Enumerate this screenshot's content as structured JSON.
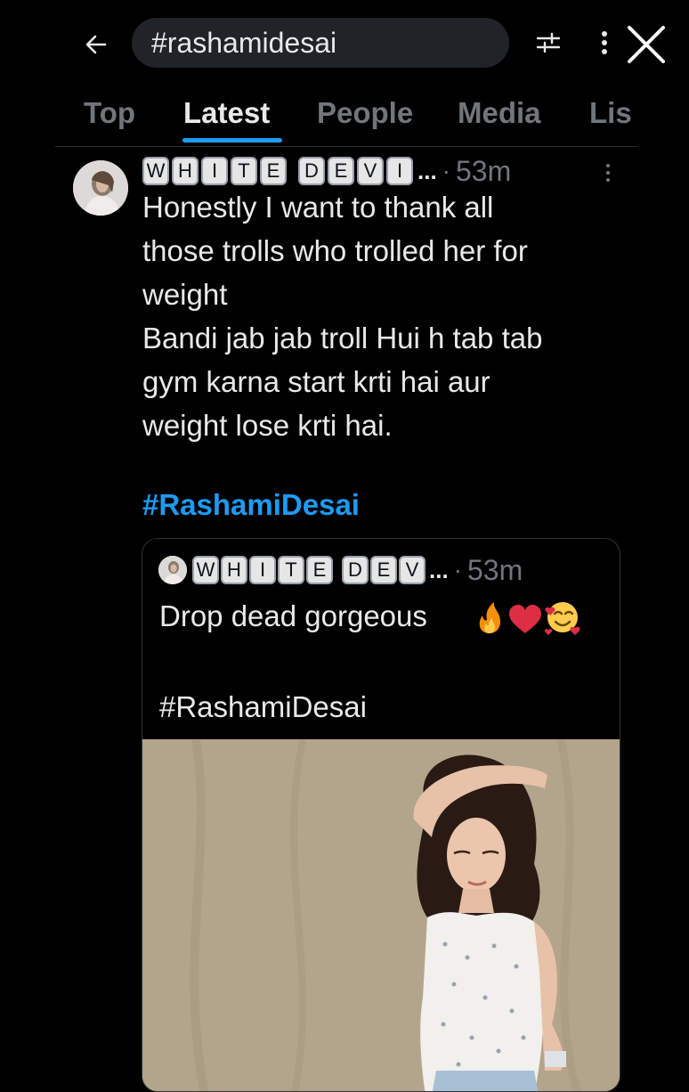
{
  "search": {
    "query": "#rashamidesai"
  },
  "header": {
    "back_icon": "arrow-left-icon",
    "filter_icon": "sliders-icon",
    "more_icon": "vertical-dots-icon",
    "close_icon": "close-icon"
  },
  "tabs": [
    {
      "label": "Top",
      "active": false
    },
    {
      "label": "Latest",
      "active": true
    },
    {
      "label": "People",
      "active": false
    },
    {
      "label": "Media",
      "active": false
    },
    {
      "label": "Lis",
      "active": false
    }
  ],
  "tweet": {
    "author_letters": [
      "W",
      "H",
      "I",
      "T",
      "E",
      "D",
      "E",
      "V",
      "I"
    ],
    "author_ellipsis": "...",
    "separator": "·",
    "time": "53m",
    "lines": [
      "Honestly I want to thank all",
      "those trolls who trolled her for",
      "weight",
      "Bandi jab jab troll Hui h tab tab",
      "gym karna start krti hai aur",
      "weight lose krti hai."
    ],
    "hashtag": "#RashamiDesai"
  },
  "quote": {
    "author_letters": [
      "W",
      "H",
      "I",
      "T",
      "E",
      "D",
      "E",
      "V"
    ],
    "author_ellipsis": "...",
    "separator": "·",
    "time": "53m",
    "text": "Drop dead gorgeous",
    "emojis": [
      "fire-emoji",
      "red-heart-emoji",
      "smiling-face-with-hearts-emoji"
    ],
    "hashtag": "#RashamiDesai"
  },
  "colors": {
    "background": "#000000",
    "accent": "#1d9bf0",
    "muted": "#71767b",
    "text": "#e7e9ea",
    "search_bg": "#202327"
  }
}
